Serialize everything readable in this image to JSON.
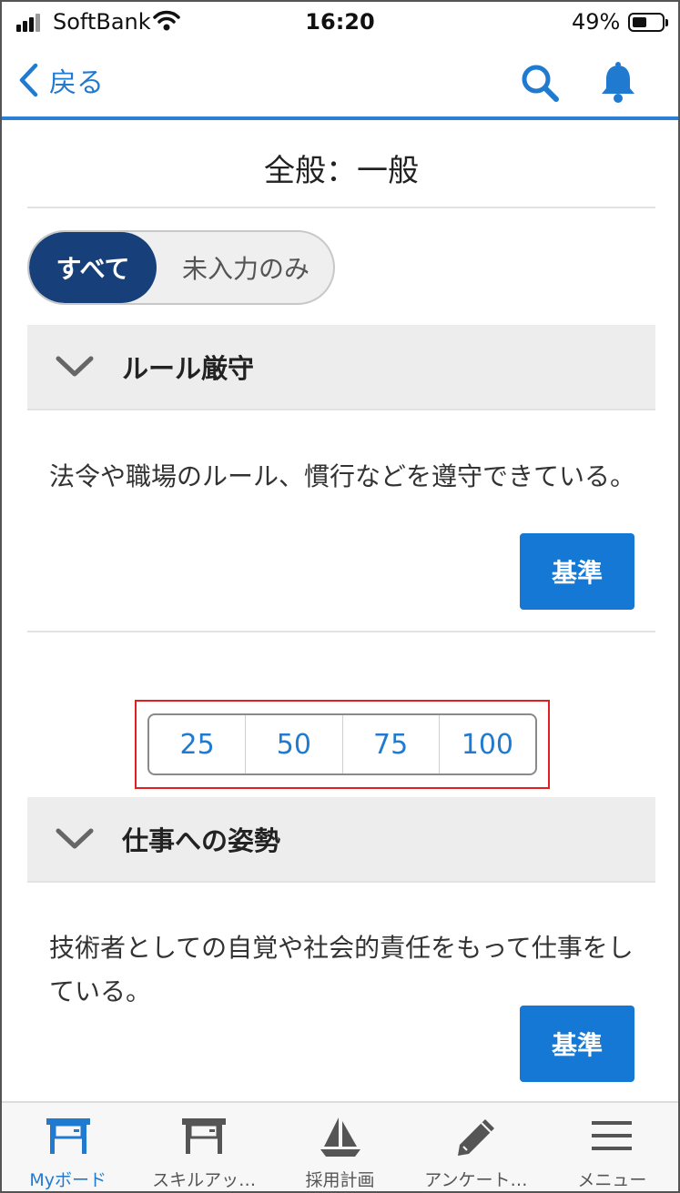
{
  "status_bar": {
    "carrier": "SoftBank",
    "time": "16:20",
    "battery": "49%",
    "battery_level": 0.49
  },
  "nav": {
    "back_label": "戻る",
    "icons": [
      "search-icon",
      "bell-icon"
    ]
  },
  "page": {
    "title": "全般：一般"
  },
  "filter": {
    "all_label": "すべて",
    "unfilled_label": "未入力のみ",
    "selected": "すべて"
  },
  "sections": [
    {
      "title": "ルール厳守",
      "description": "法令や職場のルール、慣行などを遵守できている。",
      "button_label": "基準"
    },
    {
      "title": "仕事への姿勢",
      "description": "技術者としての自覚や社会的責任をもって仕事をしている。",
      "button_label": "基準"
    }
  ],
  "score_options": [
    "25",
    "50",
    "75",
    "100"
  ],
  "tabbar": {
    "items": [
      {
        "label": "Myボード",
        "icon": "desk-icon",
        "active": true
      },
      {
        "label": "スキルアッ…",
        "icon": "desk-icon",
        "active": false
      },
      {
        "label": "採用計画",
        "icon": "sailboat-icon",
        "active": false
      },
      {
        "label": "アンケート…",
        "icon": "pencil-icon",
        "active": false
      },
      {
        "label": "メニュー",
        "icon": "menu-icon",
        "active": false
      }
    ]
  },
  "colors": {
    "accent": "#1f7ad0",
    "toggle_active": "#17407a",
    "button": "#1578d4",
    "highlight": "#e02020"
  }
}
